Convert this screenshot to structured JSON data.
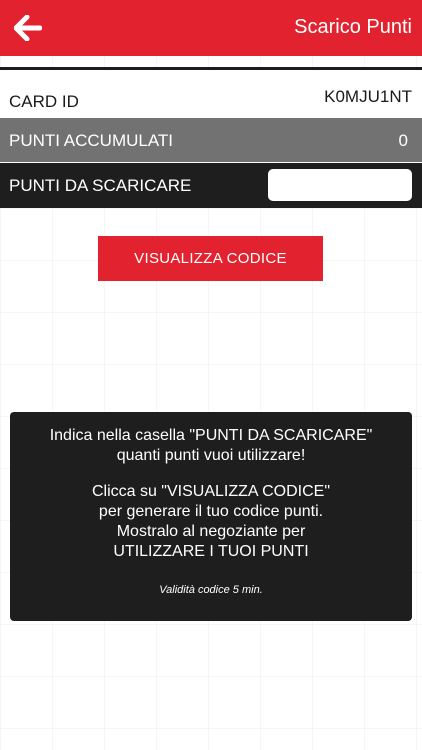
{
  "header": {
    "title": "Scarico Punti",
    "back_icon": "arrow-left-icon",
    "color": "#e3222f"
  },
  "card": {
    "label": "CARD ID",
    "value": "K0MJU1NT"
  },
  "points": {
    "label": "PUNTI ACCUMULATI",
    "value": "0"
  },
  "redeem": {
    "label": "PUNTI DA SCARICARE",
    "input_value": ""
  },
  "button": {
    "label": "VISUALIZZA CODICE"
  },
  "info": {
    "lines_a": [
      "Indica nella casella \"PUNTI DA SCARICARE\"",
      "quanti punti vuoi utilizzare!"
    ],
    "lines_b": [
      "Clicca su \"VISUALIZZA CODICE\"",
      "per generare il tuo codice punti.",
      "Mostralo al negoziante per",
      "UTILIZZARE I TUOI PUNTI"
    ],
    "validity": "Validità codice 5 min."
  }
}
